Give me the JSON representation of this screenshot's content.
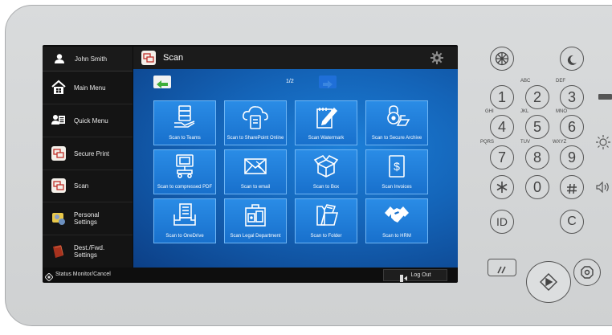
{
  "user": {
    "name": "John Smith"
  },
  "sidebar": {
    "items": [
      {
        "label": "Main Menu"
      },
      {
        "label": "Quick Menu"
      },
      {
        "label": "Secure Print"
      },
      {
        "label": "Scan"
      },
      {
        "label": "Personal Settings"
      },
      {
        "label": "Dest./Fwd. Settings"
      }
    ]
  },
  "header": {
    "title": "Scan"
  },
  "pager": {
    "text": "1/2"
  },
  "tiles": [
    {
      "label": "Scan to Teams",
      "icon": "server-hand-icon"
    },
    {
      "label": "Scan to SharePoint Online",
      "icon": "cloud-document-icon"
    },
    {
      "label": "Scan Watermark",
      "icon": "watermark-edit-icon"
    },
    {
      "label": "Scan to Secure Archive",
      "icon": "secure-archive-icon"
    },
    {
      "label": "Scan to compressed PDF",
      "icon": "compressed-pdf-icon"
    },
    {
      "label": "Scan to email",
      "icon": "email-icon"
    },
    {
      "label": "Scan to Box",
      "icon": "box-icon"
    },
    {
      "label": "Scan Invoices",
      "icon": "invoice-icon"
    },
    {
      "label": "Scan to OneDrive",
      "icon": "onedrive-tray-icon"
    },
    {
      "label": "Scan Legal Department",
      "icon": "legal-department-icon"
    },
    {
      "label": "Scan to Folder",
      "icon": "folder-icon"
    },
    {
      "label": "Scan to HRM",
      "icon": "handshake-icon"
    }
  ],
  "footer": {
    "status": "Status Monitor/Cancel",
    "logout": "Log Out"
  },
  "keypad": {
    "keys": [
      "1",
      "2",
      "3",
      "4",
      "5",
      "6",
      "7",
      "8",
      "9",
      "0"
    ],
    "letters": [
      "ABC",
      "DEF",
      "GHI",
      "JKL",
      "MNO",
      "PQRS",
      "TUV",
      "WXYZ"
    ],
    "id_label": "ID",
    "clear_label": "C"
  },
  "colors": {
    "accent_green": "#3fae3a",
    "tile_blue": "#1b78d4",
    "tile_border": "#6fb6f5"
  }
}
